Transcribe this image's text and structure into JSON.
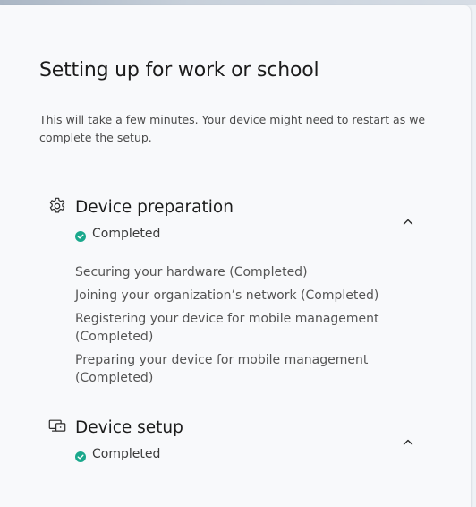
{
  "page": {
    "title": "Setting up for work or school",
    "subtitle": "This will take a few minutes. Your device might need to restart as we complete the setup."
  },
  "sections": [
    {
      "icon": "gear-icon",
      "title": "Device preparation",
      "status": "Completed",
      "expanded": true,
      "steps": [
        "Securing your hardware (Completed)",
        "Joining your organization’s network (Completed)",
        "Registering your device for mobile management (Completed)",
        "Preparing your device for mobile management (Completed)"
      ]
    },
    {
      "icon": "device-setup-icon",
      "title": "Device setup",
      "status": "Completed",
      "expanded": true,
      "steps": []
    }
  ],
  "colors": {
    "success": "#1aa88c",
    "text_primary": "#1b1b1b",
    "text_secondary": "#545454",
    "panel_bg": "#f8f9fb"
  }
}
